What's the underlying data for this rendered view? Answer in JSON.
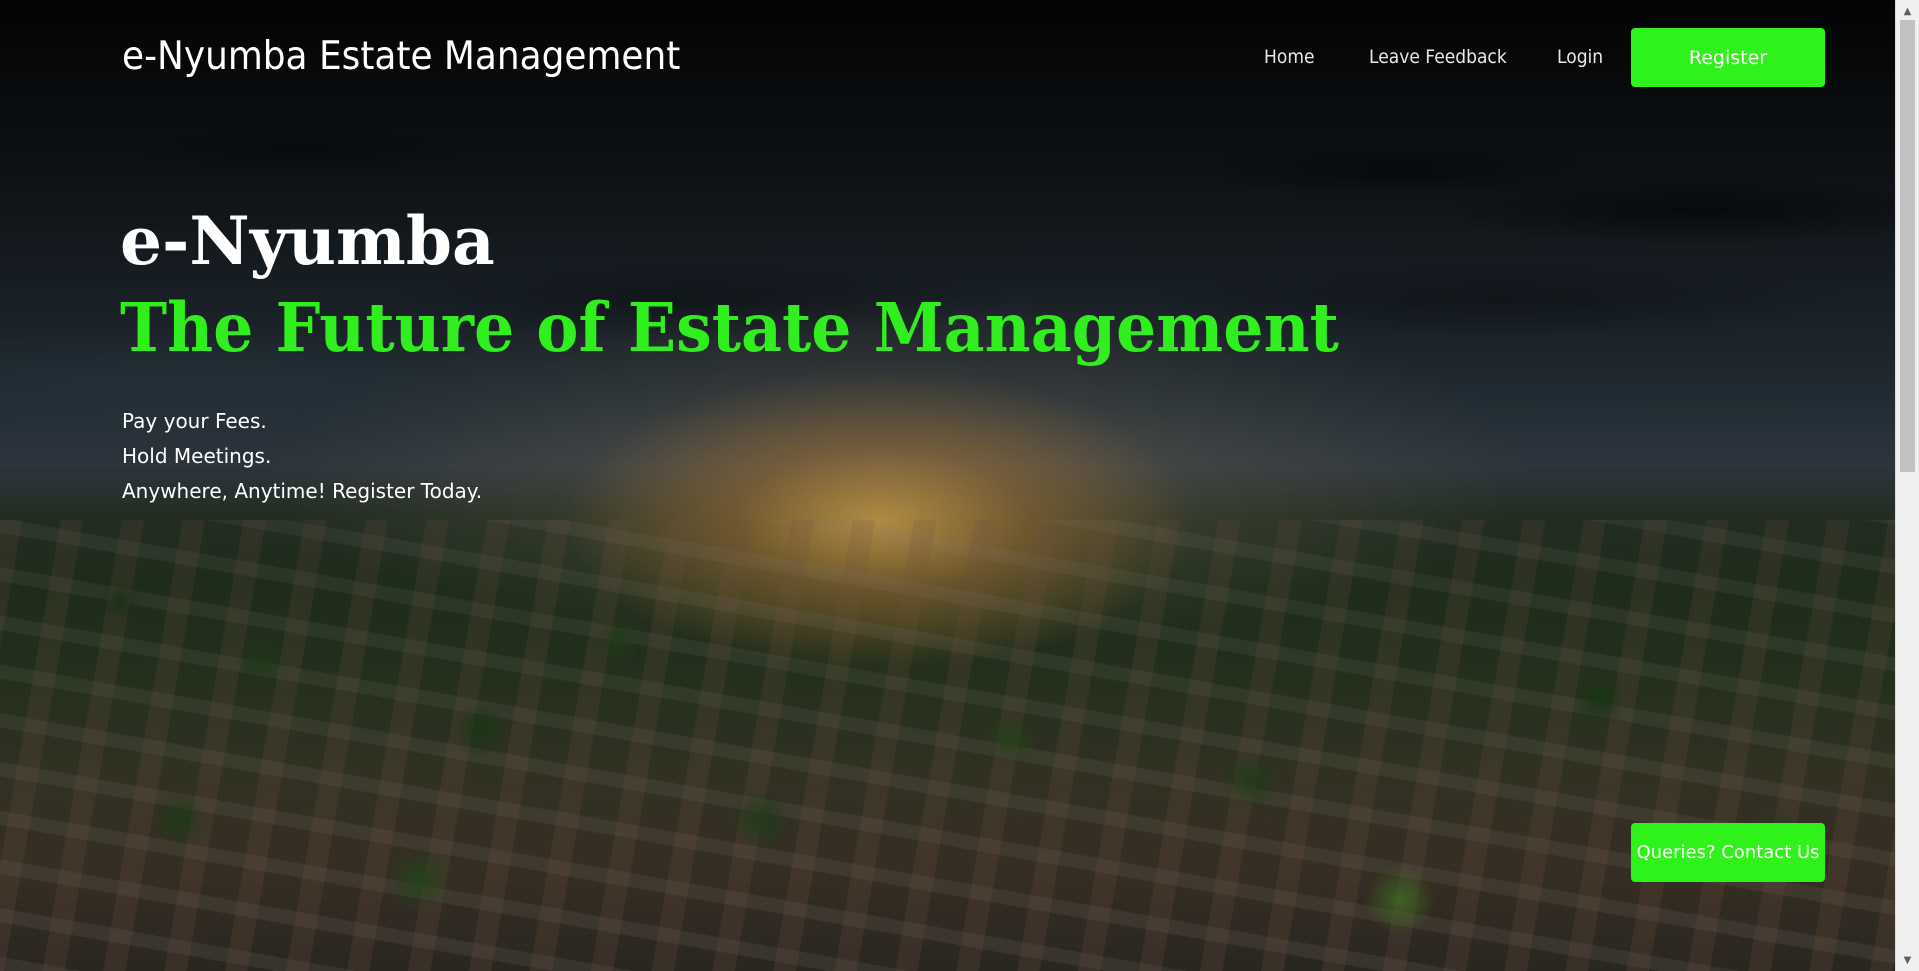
{
  "navbar": {
    "brand": "e-Nyumba Estate Management",
    "links": [
      {
        "label": "Home"
      },
      {
        "label": "Leave Feedback"
      },
      {
        "label": "Login"
      }
    ],
    "register_label": "Register"
  },
  "hero": {
    "title": "e-Nyumba",
    "subtitle": "The Future of Estate Management",
    "lines": [
      "Pay your Fees.",
      "Hold Meetings.",
      "Anywhere, Anytime! Register Today."
    ]
  },
  "contact_button": {
    "label": "Queries? Contact Us"
  },
  "colors": {
    "accent_green": "#2ef21a",
    "headline_green": "#31ee1f",
    "text_white": "#ffffff"
  }
}
